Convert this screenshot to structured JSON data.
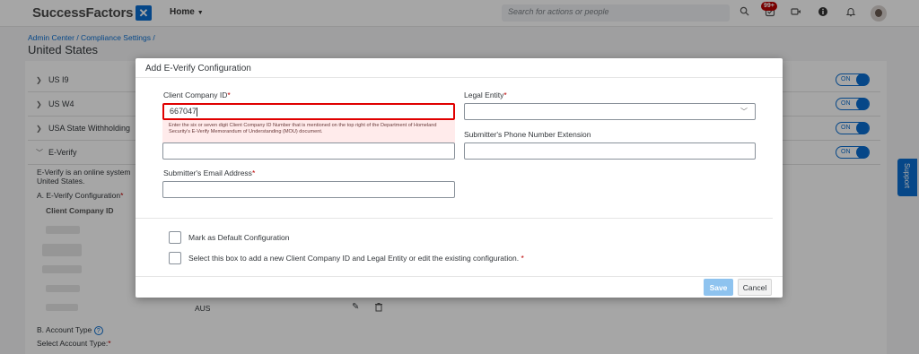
{
  "shell": {
    "logo_text": "SuccessFactors",
    "home_label": "Home",
    "search_placeholder": "Search for actions or people",
    "notification_count": "99+"
  },
  "page": {
    "breadcrumb": "Admin Center / Compliance Settings /",
    "title": "United States"
  },
  "sections": [
    {
      "label": "US I9",
      "toggle": "ON"
    },
    {
      "label": "US W4",
      "toggle": "ON"
    },
    {
      "label": "USA State Withholding",
      "toggle": "ON"
    },
    {
      "label": "E-Verify",
      "toggle": "ON"
    }
  ],
  "background": {
    "everify_desc_1": "E-Verify is an online system",
    "everify_desc_2": "United States.",
    "config_heading": "A. E-Verify Configuration",
    "client_col": "Client Company ID",
    "row_value": "AUS",
    "account_type": "B. Account Type",
    "select_account": "Select Account Type:"
  },
  "support_label": "Support",
  "dialog": {
    "title": "Add E-Verify Configuration",
    "client_id_label": "Client Company ID",
    "client_id_value": "667047",
    "client_id_error": "Enter the six or seven digit Client Company ID Number that is mentioned on the top right of the Department of Homeland Security's E-Verify Memorandum of Understanding (MOU) document.",
    "legal_entity_label": "Legal Entity",
    "legal_entity_value": "",
    "phone_ext_label": "Submitter's Phone Number Extension",
    "email_label": "Submitter's Email Address",
    "default_config_label": "Mark as Default Configuration",
    "add_new_label": "Select this box to add a new Client Company ID and Legal Entity or edit the existing configuration.",
    "save_label": "Save",
    "cancel_label": "Cancel"
  },
  "colors": {
    "accent": "#0a6ed1",
    "error": "#e00000",
    "required": "#bb0000"
  }
}
